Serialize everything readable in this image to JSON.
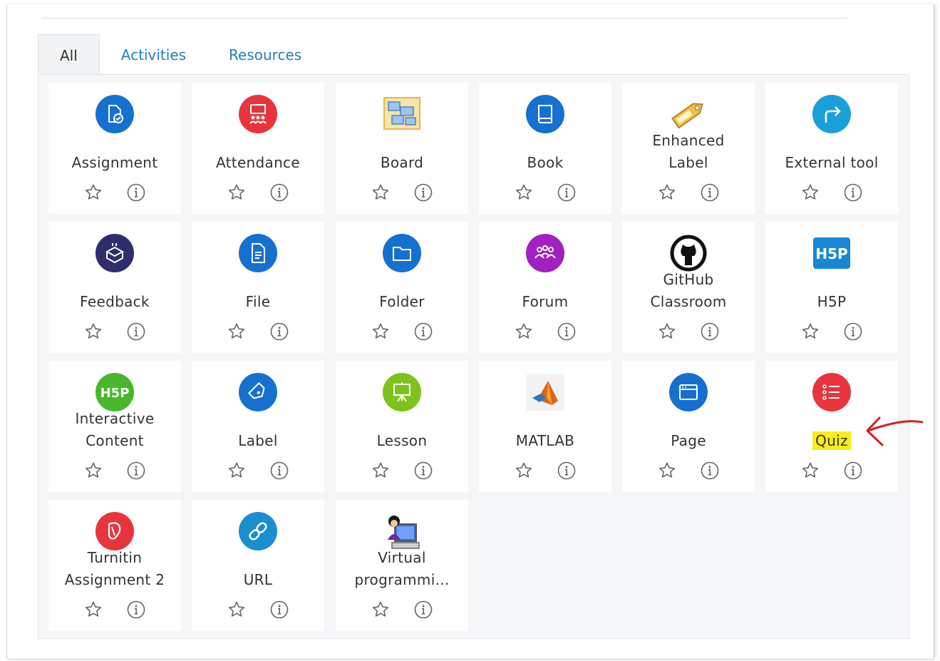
{
  "tabs": [
    {
      "label": "All"
    },
    {
      "label": "Activities"
    },
    {
      "label": "Resources"
    }
  ],
  "items": [
    {
      "name": "Assignment",
      "line2": "",
      "icon": "assignment-icon",
      "color": "#1670d0"
    },
    {
      "name": "Attendance",
      "line2": "",
      "icon": "attendance-icon",
      "color": "#e8353d"
    },
    {
      "name": "Board",
      "line2": "",
      "icon": "board-icon",
      "color": "#e8b84a"
    },
    {
      "name": "Book",
      "line2": "",
      "icon": "book-icon",
      "color": "#1670d0"
    },
    {
      "name": "Enhanced",
      "line2": "Label",
      "icon": "enhanced-label-icon",
      "color": "#f0c24a"
    },
    {
      "name": "External tool",
      "line2": "",
      "icon": "external-tool-icon",
      "color": "#1aa0d8"
    },
    {
      "name": "Feedback",
      "line2": "",
      "icon": "feedback-icon",
      "color": "#2f2d6b"
    },
    {
      "name": "File",
      "line2": "",
      "icon": "file-icon",
      "color": "#1670d0"
    },
    {
      "name": "Folder",
      "line2": "",
      "icon": "folder-icon",
      "color": "#1670d0"
    },
    {
      "name": "Forum",
      "line2": "",
      "icon": "forum-icon",
      "color": "#a020c0"
    },
    {
      "name": "GitHub",
      "line2": "Classroom",
      "icon": "github-icon",
      "color": "#111111"
    },
    {
      "name": "H5P",
      "line2": "",
      "icon": "h5p-icon",
      "color": "#1a86d6"
    },
    {
      "name": "Interactive",
      "line2": "Content",
      "icon": "h5p-interactive-icon",
      "color": "#49b62d"
    },
    {
      "name": "Label",
      "line2": "",
      "icon": "label-icon",
      "color": "#1670d0"
    },
    {
      "name": "Lesson",
      "line2": "",
      "icon": "lesson-icon",
      "color": "#7dc31c"
    },
    {
      "name": "MATLAB",
      "line2": "",
      "icon": "matlab-icon",
      "color": "#e1621b"
    },
    {
      "name": "Page",
      "line2": "",
      "icon": "page-icon",
      "color": "#1670d0"
    },
    {
      "name": "Quiz",
      "line2": "",
      "icon": "quiz-icon",
      "color": "#e8353d"
    },
    {
      "name": "Turnitin",
      "line2": "Assignment 2",
      "icon": "turnitin-icon",
      "color": "#e8353d"
    },
    {
      "name": "URL",
      "line2": "",
      "icon": "url-icon",
      "color": "#1a8fd0"
    },
    {
      "name": "Virtual",
      "line2": "programmi...",
      "icon": "virtual-programming-icon",
      "color": "#6a2aa0"
    }
  ],
  "highlight_color": "#f7ef16",
  "annotation_arrow_color": "#d42020"
}
